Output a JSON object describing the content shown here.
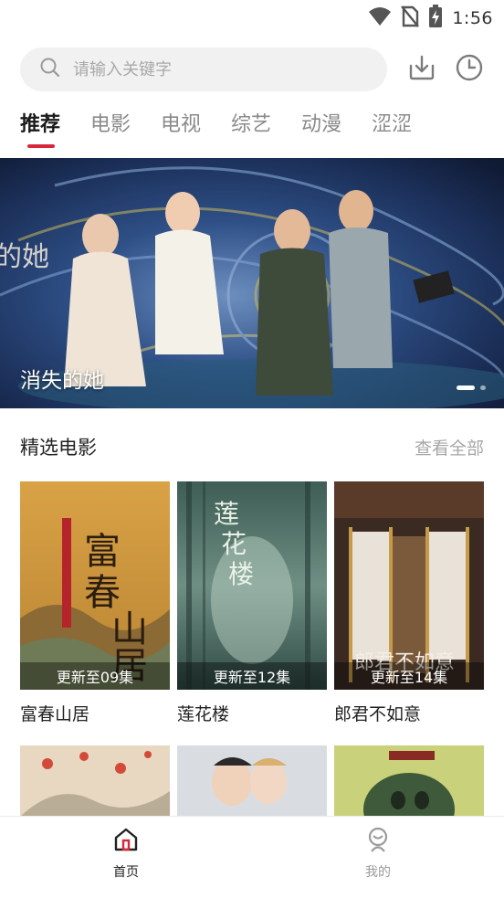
{
  "status_bar": {
    "time": "1:56",
    "icons": [
      "wifi-icon",
      "no-sim-icon",
      "battery-charging-icon"
    ]
  },
  "search": {
    "placeholder": "请输入关键字",
    "icons": [
      "search-icon",
      "download-icon",
      "history-icon"
    ]
  },
  "tabs": [
    {
      "label": "推荐",
      "active": true
    },
    {
      "label": "电影",
      "active": false
    },
    {
      "label": "电视",
      "active": false
    },
    {
      "label": "综艺",
      "active": false
    },
    {
      "label": "动漫",
      "active": false
    },
    {
      "label": "涩涩",
      "active": false
    }
  ],
  "banner": {
    "title": "消失的她",
    "page_count": 2,
    "current_page": 1
  },
  "section": {
    "title": "精选电影",
    "more": "查看全部"
  },
  "movies": [
    {
      "name": "富春山居",
      "badge": "更新至09集"
    },
    {
      "name": "莲花楼",
      "badge": "更新至12集"
    },
    {
      "name": "郎君不如意",
      "badge": "更新至14集"
    }
  ],
  "bottom_nav": [
    {
      "label": "首页",
      "active": true,
      "icon": "home-icon"
    },
    {
      "label": "我的",
      "active": false,
      "icon": "profile-icon"
    }
  ],
  "colors": {
    "accent": "#d6283a",
    "inactive": "#8a8a8a",
    "search_bg": "#f1f1f1"
  }
}
